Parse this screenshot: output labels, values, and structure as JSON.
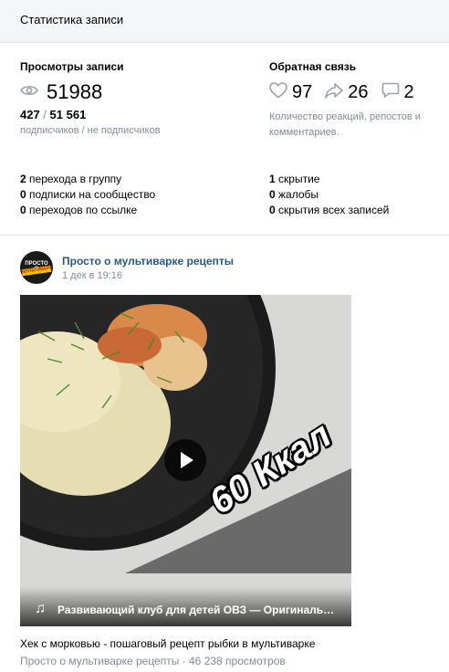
{
  "header": {
    "title": "Статистика записи"
  },
  "views": {
    "title": "Просмотры записи",
    "icon": "eye-icon",
    "count": "51988",
    "subscribers": "427",
    "separator": " / ",
    "non_subscribers": "51 561",
    "caption": "подписчиков / не подписчиков"
  },
  "feedback": {
    "title": "Обратная связь",
    "likes": {
      "icon": "heart-icon",
      "count": "97"
    },
    "reposts": {
      "icon": "share-icon",
      "count": "26"
    },
    "comments": {
      "icon": "comment-icon",
      "count": "2"
    },
    "caption": "Количество реакций, репостов и комментариев."
  },
  "left_list": [
    {
      "value": "2",
      "label": " перехода в группу"
    },
    {
      "value": "0",
      "label": " подписки на сообщество"
    },
    {
      "value": "0",
      "label": " переходов по ссылке"
    }
  ],
  "right_list": [
    {
      "value": "1",
      "label": " скрытие"
    },
    {
      "value": "0",
      "label": " жалобы"
    },
    {
      "value": "0",
      "label": " скрытия всех записей"
    }
  ],
  "post": {
    "group_name": "Просто о мультиварке рецепты",
    "date": "1 дек в 19:16",
    "avatar_logo_top": "ПРОСТО О",
    "avatar_logo_band": "МУЛЬТИВАРКЕ",
    "video": {
      "overlay_text": "60 Ккал",
      "music_caption": "Развивающий клуб для детей ОВЗ — Оригинальный звук",
      "title": "Хек с морковью - пошаговый рецепт рыбки в мультиварке",
      "meta": "Просто о мультиварке рецепты · 46 238 просмотров"
    }
  },
  "colors": {
    "link": "#2a5885",
    "muted": "#818c99",
    "icon": "#99a2ad"
  }
}
